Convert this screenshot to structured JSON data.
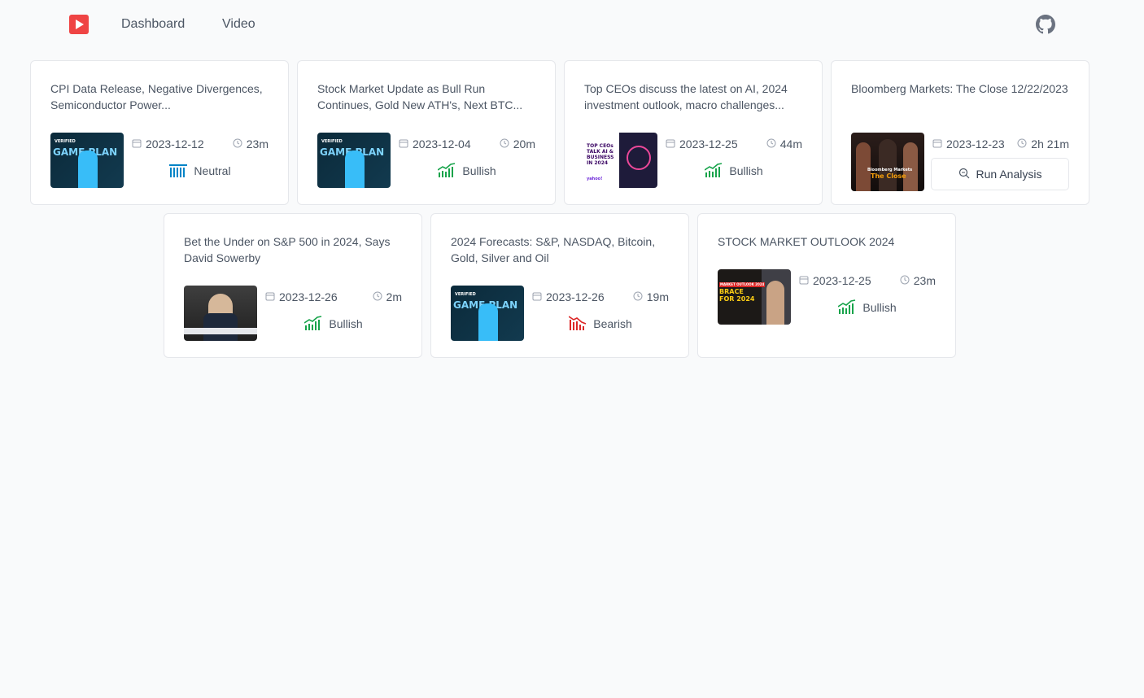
{
  "nav": {
    "logo_icon": "play-icon",
    "links": [
      "Dashboard",
      "Video"
    ],
    "github_icon": "github-icon"
  },
  "colors": {
    "brand": "#ef4444",
    "neutral": "#0284c7",
    "bullish": "#16a34a",
    "bearish": "#dc2626"
  },
  "cards": [
    {
      "title": "CPI Data Release, Negative Divergences, Semiconductor Power...",
      "date": "2023-12-12",
      "duration": "23m",
      "sentiment": "Neutral",
      "thumb_text": "GAME PLAN",
      "thumb_top": "VERIFIED"
    },
    {
      "title": "Stock Market Update as Bull Run Continues, Gold New ATH's, Next BTC...",
      "date": "2023-12-04",
      "duration": "20m",
      "sentiment": "Bullish",
      "thumb_text": "GAME PLAN",
      "thumb_top": "VERIFIED"
    },
    {
      "title": "Top CEOs discuss the latest on AI, 2024 investment outlook, macro challenges...",
      "date": "2023-12-25",
      "duration": "44m",
      "sentiment": "Bullish",
      "thumb_text": "TOP CEOs TALK AI & BUSINESS IN 2024",
      "thumb_top": "yahoo!"
    },
    {
      "title": "Bloomberg Markets: The Close 12/22/2023",
      "date": "2023-12-23",
      "duration": "2h 21m",
      "action": "Run Analysis",
      "thumb_text": "The Close",
      "thumb_top": "Bloomberg Markets"
    },
    {
      "title": "Bet the Under on S&P 500 in 2024, Says David Sowerby",
      "date": "2023-12-26",
      "duration": "2m",
      "sentiment": "Bullish",
      "thumb_text": "",
      "thumb_top": ""
    },
    {
      "title": "2024 Forecasts: S&P, NASDAQ, Bitcoin, Gold, Silver and Oil",
      "date": "2023-12-26",
      "duration": "19m",
      "sentiment": "Bearish",
      "thumb_text": "GAME PLAN",
      "thumb_top": "VERIFIED"
    },
    {
      "title": "STOCK MARKET OUTLOOK 2024",
      "date": "2023-12-25",
      "duration": "23m",
      "sentiment": "Bullish",
      "thumb_text": "BRACE FOR 2024",
      "thumb_top": "MARKET OUTLOOK 2024"
    }
  ]
}
